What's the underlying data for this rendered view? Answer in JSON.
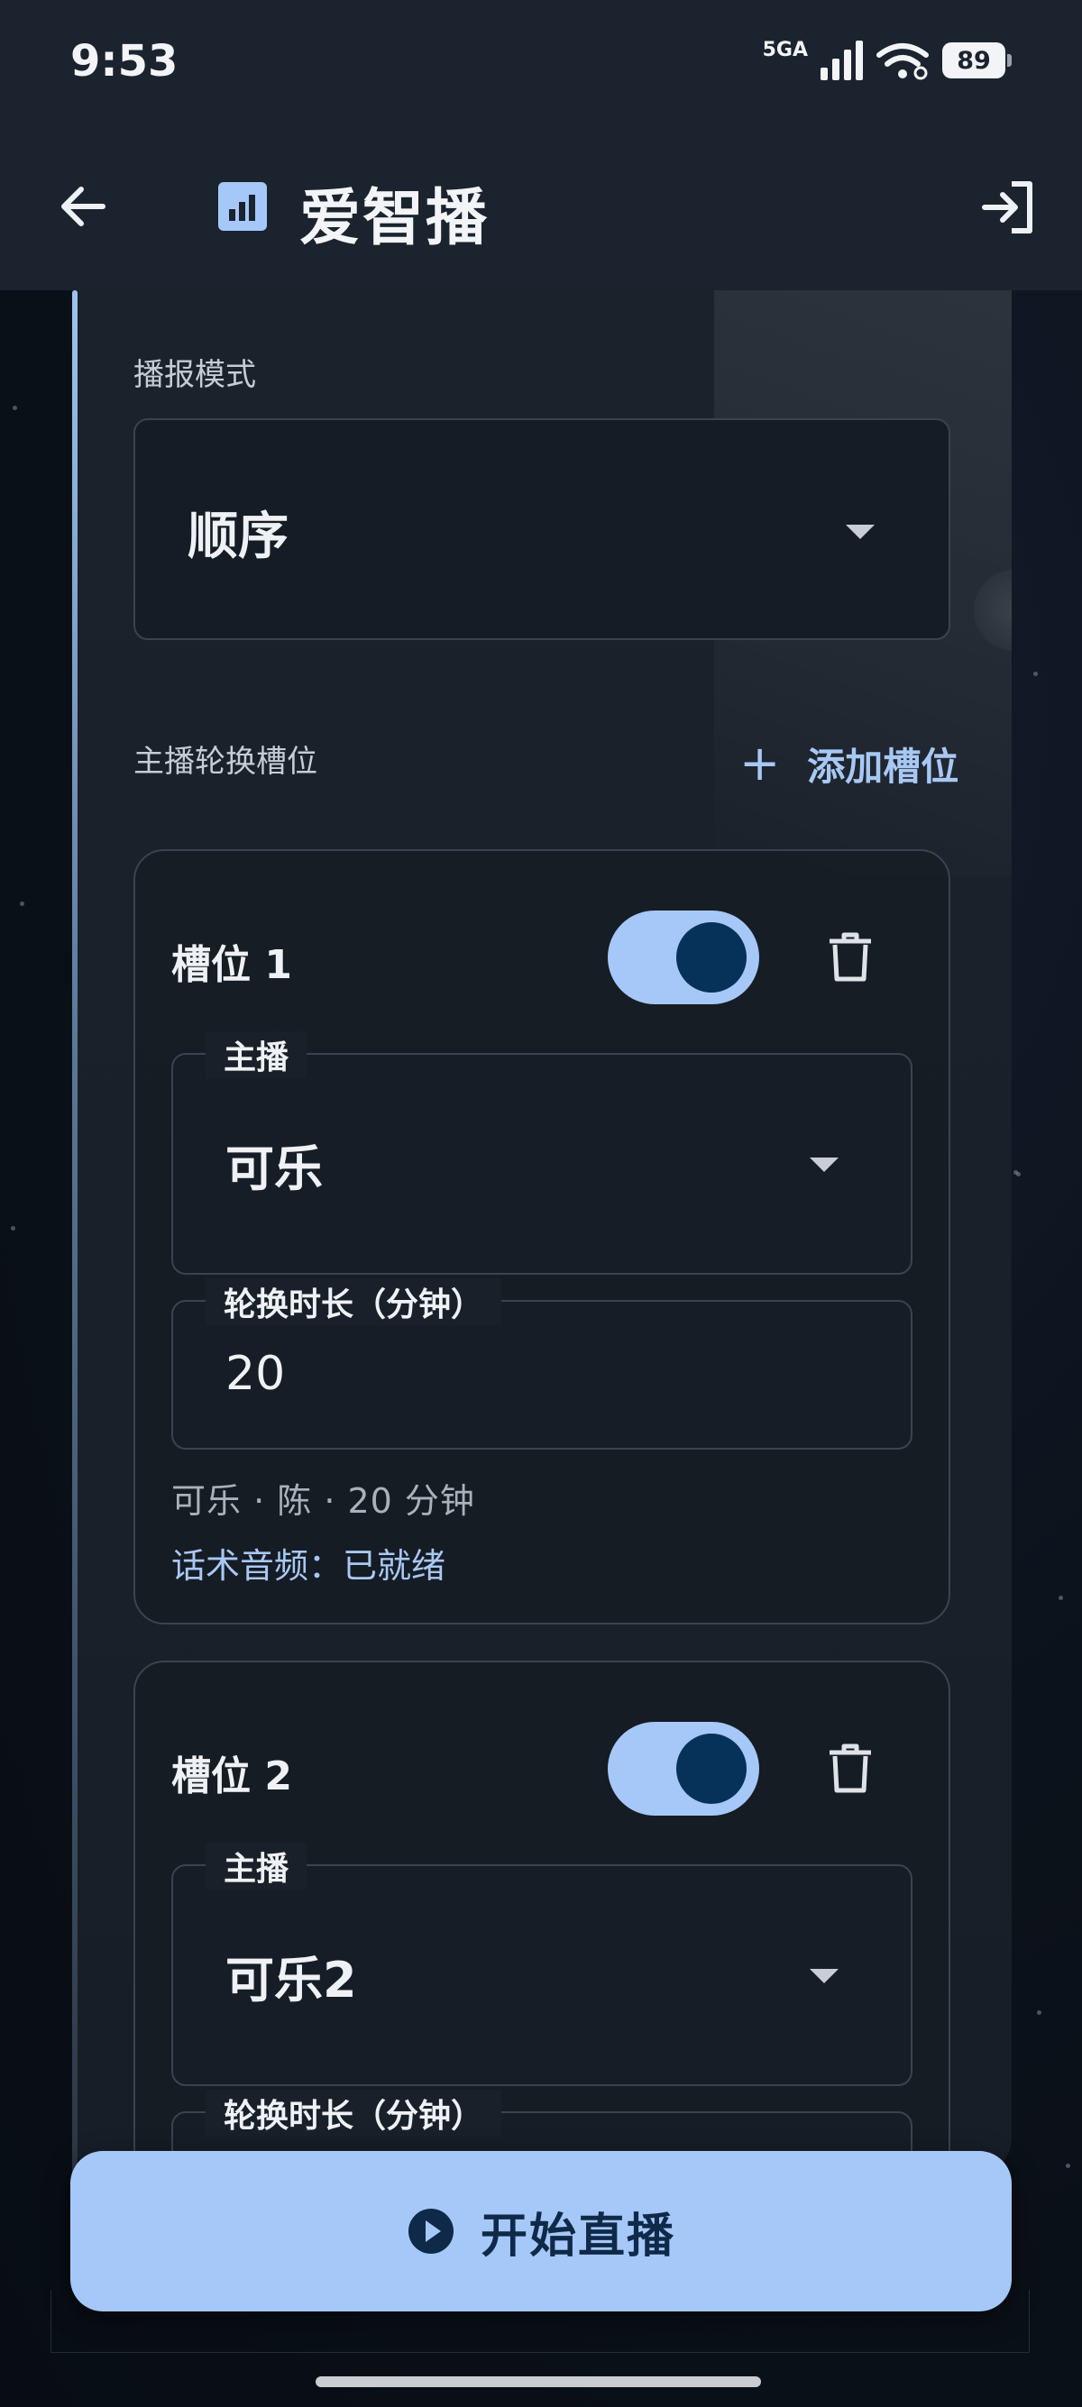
{
  "status_bar": {
    "time": "9:53",
    "network": "5GA",
    "battery": "89"
  },
  "app_bar": {
    "title": "爱智播",
    "back_icon": "arrow-left-icon",
    "logo_icon": "bar-chart-icon",
    "logout_icon": "logout-icon"
  },
  "broadcast_mode": {
    "label": "播报模式",
    "value": "顺序"
  },
  "rotation": {
    "label": "主播轮换槽位",
    "add_button": "添加槽位",
    "slots": [
      {
        "title": "槽位 1",
        "enabled": true,
        "host_label": "主播",
        "host_value": "可乐",
        "duration_label": "轮换时长（分钟）",
        "duration_value": "20",
        "summary": "可乐 · 陈 · 20 分钟",
        "audio_status": "话术音频：已就绪"
      },
      {
        "title": "槽位 2",
        "enabled": true,
        "host_label": "主播",
        "host_value": "可乐2",
        "duration_label": "轮换时长（分钟）"
      }
    ]
  },
  "start_button": {
    "label": "开始直播",
    "icon": "play-circle-icon"
  },
  "colors": {
    "accent": "#a6c8f8",
    "accent_dark": "#06325a",
    "background": "#0b1119",
    "card": "#1b222c"
  }
}
